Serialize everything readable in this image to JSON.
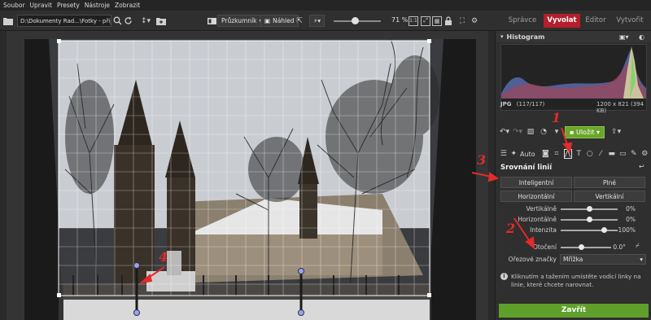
{
  "menu": [
    "Soubor",
    "Upravit",
    "Presety",
    "Nástroje",
    "Zobrazit"
  ],
  "toolbar": {
    "path": "D:\\Dokumenty Rad...\\Fotky - přijaté",
    "browser_label": "Průzkumník",
    "preview_label": "Náhled",
    "zoom_value": "71 %",
    "zoom_fraction": 0.38
  },
  "tabs": {
    "spravce": "Správce",
    "vyvolat": "Vyvolat",
    "editor": "Editor",
    "vytvorit": "Vytvořit"
  },
  "histogram": {
    "title": "Histogram",
    "format": "JPG",
    "count": "(117/117)",
    "dims": "1200 x 821 (394 KB)"
  },
  "save_label": "Uložit",
  "auto_label": "Auto",
  "tool": {
    "title": "Srovnání linií",
    "buttons": [
      "Inteligentní",
      "Plné",
      "Horizontální",
      "Vertikální"
    ],
    "sliders": [
      {
        "label": "Vertikálně",
        "value": "0%",
        "fraction": 0.5
      },
      {
        "label": "Horizontálně",
        "value": "0%",
        "fraction": 0.5
      },
      {
        "label": "Intenzita",
        "value": "100%",
        "fraction": 1.0
      }
    ],
    "rotation": {
      "label": "Otočení",
      "value": "0.0°",
      "fraction": 0.5
    },
    "crop_marks": {
      "label": "Ořezové značky",
      "value": "Mřížka"
    },
    "info": "Kliknutím a tažením umístěte vodicí linky na linie, které chcete narovnat."
  },
  "close_label": "Zavřít",
  "annotations": [
    "1",
    "2",
    "3",
    "4"
  ],
  "colors": {
    "accent_red": "#b51e2a",
    "save_green": "#6aa62a",
    "annotation_red": "#e42a2a"
  }
}
